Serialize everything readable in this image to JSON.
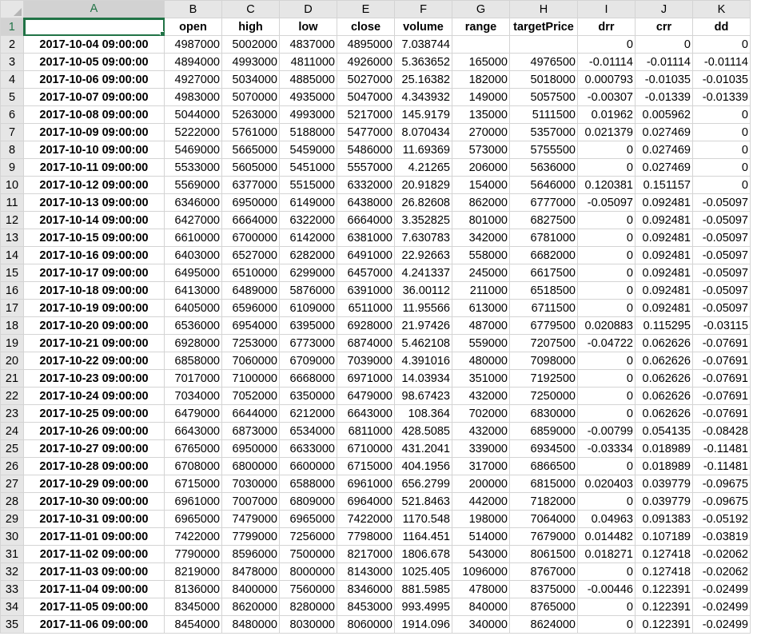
{
  "sheet": {
    "columns": [
      "A",
      "B",
      "C",
      "D",
      "E",
      "F",
      "G",
      "H",
      "I",
      "J",
      "K"
    ],
    "active_column": "A",
    "active_row": "1",
    "header_row": {
      "row": "1",
      "cells": [
        "",
        "open",
        "high",
        "low",
        "close",
        "volume",
        "range",
        "targetPrice",
        "drr",
        "crr",
        "dd"
      ]
    },
    "rows": [
      {
        "row": "2",
        "date": "2017-10-04 09:00:00",
        "values": [
          "4987000",
          "5002000",
          "4837000",
          "4895000",
          "7.038744",
          "",
          "",
          "0",
          "0",
          "0"
        ]
      },
      {
        "row": "3",
        "date": "2017-10-05 09:00:00",
        "values": [
          "4894000",
          "4993000",
          "4811000",
          "4926000",
          "5.363652",
          "165000",
          "4976500",
          "-0.01114",
          "-0.01114",
          "-0.01114"
        ]
      },
      {
        "row": "4",
        "date": "2017-10-06 09:00:00",
        "values": [
          "4927000",
          "5034000",
          "4885000",
          "5027000",
          "25.16382",
          "182000",
          "5018000",
          "0.000793",
          "-0.01035",
          "-0.01035"
        ]
      },
      {
        "row": "5",
        "date": "2017-10-07 09:00:00",
        "values": [
          "4983000",
          "5070000",
          "4935000",
          "5047000",
          "4.343932",
          "149000",
          "5057500",
          "-0.00307",
          "-0.01339",
          "-0.01339"
        ]
      },
      {
        "row": "6",
        "date": "2017-10-08 09:00:00",
        "values": [
          "5044000",
          "5263000",
          "4993000",
          "5217000",
          "145.9179",
          "135000",
          "5111500",
          "0.01962",
          "0.005962",
          "0"
        ]
      },
      {
        "row": "7",
        "date": "2017-10-09 09:00:00",
        "values": [
          "5222000",
          "5761000",
          "5188000",
          "5477000",
          "8.070434",
          "270000",
          "5357000",
          "0.021379",
          "0.027469",
          "0"
        ]
      },
      {
        "row": "8",
        "date": "2017-10-10 09:00:00",
        "values": [
          "5469000",
          "5665000",
          "5459000",
          "5486000",
          "11.69369",
          "573000",
          "5755500",
          "0",
          "0.027469",
          "0"
        ]
      },
      {
        "row": "9",
        "date": "2017-10-11 09:00:00",
        "values": [
          "5533000",
          "5605000",
          "5451000",
          "5557000",
          "4.21265",
          "206000",
          "5636000",
          "0",
          "0.027469",
          "0"
        ]
      },
      {
        "row": "10",
        "date": "2017-10-12 09:00:00",
        "values": [
          "5569000",
          "6377000",
          "5515000",
          "6332000",
          "20.91829",
          "154000",
          "5646000",
          "0.120381",
          "0.151157",
          "0"
        ]
      },
      {
        "row": "11",
        "date": "2017-10-13 09:00:00",
        "values": [
          "6346000",
          "6950000",
          "6149000",
          "6438000",
          "26.82608",
          "862000",
          "6777000",
          "-0.05097",
          "0.092481",
          "-0.05097"
        ]
      },
      {
        "row": "12",
        "date": "2017-10-14 09:00:00",
        "values": [
          "6427000",
          "6664000",
          "6322000",
          "6664000",
          "3.352825",
          "801000",
          "6827500",
          "0",
          "0.092481",
          "-0.05097"
        ]
      },
      {
        "row": "13",
        "date": "2017-10-15 09:00:00",
        "values": [
          "6610000",
          "6700000",
          "6142000",
          "6381000",
          "7.630783",
          "342000",
          "6781000",
          "0",
          "0.092481",
          "-0.05097"
        ]
      },
      {
        "row": "14",
        "date": "2017-10-16 09:00:00",
        "values": [
          "6403000",
          "6527000",
          "6282000",
          "6491000",
          "22.92663",
          "558000",
          "6682000",
          "0",
          "0.092481",
          "-0.05097"
        ]
      },
      {
        "row": "15",
        "date": "2017-10-17 09:00:00",
        "values": [
          "6495000",
          "6510000",
          "6299000",
          "6457000",
          "4.241337",
          "245000",
          "6617500",
          "0",
          "0.092481",
          "-0.05097"
        ]
      },
      {
        "row": "16",
        "date": "2017-10-18 09:00:00",
        "values": [
          "6413000",
          "6489000",
          "5876000",
          "6391000",
          "36.00112",
          "211000",
          "6518500",
          "0",
          "0.092481",
          "-0.05097"
        ]
      },
      {
        "row": "17",
        "date": "2017-10-19 09:00:00",
        "values": [
          "6405000",
          "6596000",
          "6109000",
          "6511000",
          "11.95566",
          "613000",
          "6711500",
          "0",
          "0.092481",
          "-0.05097"
        ]
      },
      {
        "row": "18",
        "date": "2017-10-20 09:00:00",
        "values": [
          "6536000",
          "6954000",
          "6395000",
          "6928000",
          "21.97426",
          "487000",
          "6779500",
          "0.020883",
          "0.115295",
          "-0.03115"
        ]
      },
      {
        "row": "19",
        "date": "2017-10-21 09:00:00",
        "values": [
          "6928000",
          "7253000",
          "6773000",
          "6874000",
          "5.462108",
          "559000",
          "7207500",
          "-0.04722",
          "0.062626",
          "-0.07691"
        ]
      },
      {
        "row": "20",
        "date": "2017-10-22 09:00:00",
        "values": [
          "6858000",
          "7060000",
          "6709000",
          "7039000",
          "4.391016",
          "480000",
          "7098000",
          "0",
          "0.062626",
          "-0.07691"
        ]
      },
      {
        "row": "21",
        "date": "2017-10-23 09:00:00",
        "values": [
          "7017000",
          "7100000",
          "6668000",
          "6971000",
          "14.03934",
          "351000",
          "7192500",
          "0",
          "0.062626",
          "-0.07691"
        ]
      },
      {
        "row": "22",
        "date": "2017-10-24 09:00:00",
        "values": [
          "7034000",
          "7052000",
          "6350000",
          "6479000",
          "98.67423",
          "432000",
          "7250000",
          "0",
          "0.062626",
          "-0.07691"
        ]
      },
      {
        "row": "23",
        "date": "2017-10-25 09:00:00",
        "values": [
          "6479000",
          "6644000",
          "6212000",
          "6643000",
          "108.364",
          "702000",
          "6830000",
          "0",
          "0.062626",
          "-0.07691"
        ]
      },
      {
        "row": "24",
        "date": "2017-10-26 09:00:00",
        "values": [
          "6643000",
          "6873000",
          "6534000",
          "6811000",
          "428.5085",
          "432000",
          "6859000",
          "-0.00799",
          "0.054135",
          "-0.08428"
        ]
      },
      {
        "row": "25",
        "date": "2017-10-27 09:00:00",
        "values": [
          "6765000",
          "6950000",
          "6633000",
          "6710000",
          "431.2041",
          "339000",
          "6934500",
          "-0.03334",
          "0.018989",
          "-0.11481"
        ]
      },
      {
        "row": "26",
        "date": "2017-10-28 09:00:00",
        "values": [
          "6708000",
          "6800000",
          "6600000",
          "6715000",
          "404.1956",
          "317000",
          "6866500",
          "0",
          "0.018989",
          "-0.11481"
        ]
      },
      {
        "row": "27",
        "date": "2017-10-29 09:00:00",
        "values": [
          "6715000",
          "7030000",
          "6588000",
          "6961000",
          "656.2799",
          "200000",
          "6815000",
          "0.020403",
          "0.039779",
          "-0.09675"
        ]
      },
      {
        "row": "28",
        "date": "2017-10-30 09:00:00",
        "values": [
          "6961000",
          "7007000",
          "6809000",
          "6964000",
          "521.8463",
          "442000",
          "7182000",
          "0",
          "0.039779",
          "-0.09675"
        ]
      },
      {
        "row": "29",
        "date": "2017-10-31 09:00:00",
        "values": [
          "6965000",
          "7479000",
          "6965000",
          "7422000",
          "1170.548",
          "198000",
          "7064000",
          "0.04963",
          "0.091383",
          "-0.05192"
        ]
      },
      {
        "row": "30",
        "date": "2017-11-01 09:00:00",
        "values": [
          "7422000",
          "7799000",
          "7256000",
          "7798000",
          "1164.451",
          "514000",
          "7679000",
          "0.014482",
          "0.107189",
          "-0.03819"
        ]
      },
      {
        "row": "31",
        "date": "2017-11-02 09:00:00",
        "values": [
          "7790000",
          "8596000",
          "7500000",
          "8217000",
          "1806.678",
          "543000",
          "8061500",
          "0.018271",
          "0.127418",
          "-0.02062"
        ]
      },
      {
        "row": "32",
        "date": "2017-11-03 09:00:00",
        "values": [
          "8219000",
          "8478000",
          "8000000",
          "8143000",
          "1025.405",
          "1096000",
          "8767000",
          "0",
          "0.127418",
          "-0.02062"
        ]
      },
      {
        "row": "33",
        "date": "2017-11-04 09:00:00",
        "values": [
          "8136000",
          "8400000",
          "7560000",
          "8346000",
          "881.5985",
          "478000",
          "8375000",
          "-0.00446",
          "0.122391",
          "-0.02499"
        ]
      },
      {
        "row": "34",
        "date": "2017-11-05 09:00:00",
        "values": [
          "8345000",
          "8620000",
          "8280000",
          "8453000",
          "993.4995",
          "840000",
          "8765000",
          "0",
          "0.122391",
          "-0.02499"
        ]
      },
      {
        "row": "35",
        "date": "2017-11-06 09:00:00",
        "values": [
          "8454000",
          "8480000",
          "8030000",
          "8060000",
          "1914.096",
          "340000",
          "8624000",
          "0",
          "0.122391",
          "-0.02499"
        ]
      }
    ]
  },
  "colors": {
    "accent": "#217346",
    "header_bg": "#e6e6e6",
    "gridline": "#d4d4d4"
  }
}
